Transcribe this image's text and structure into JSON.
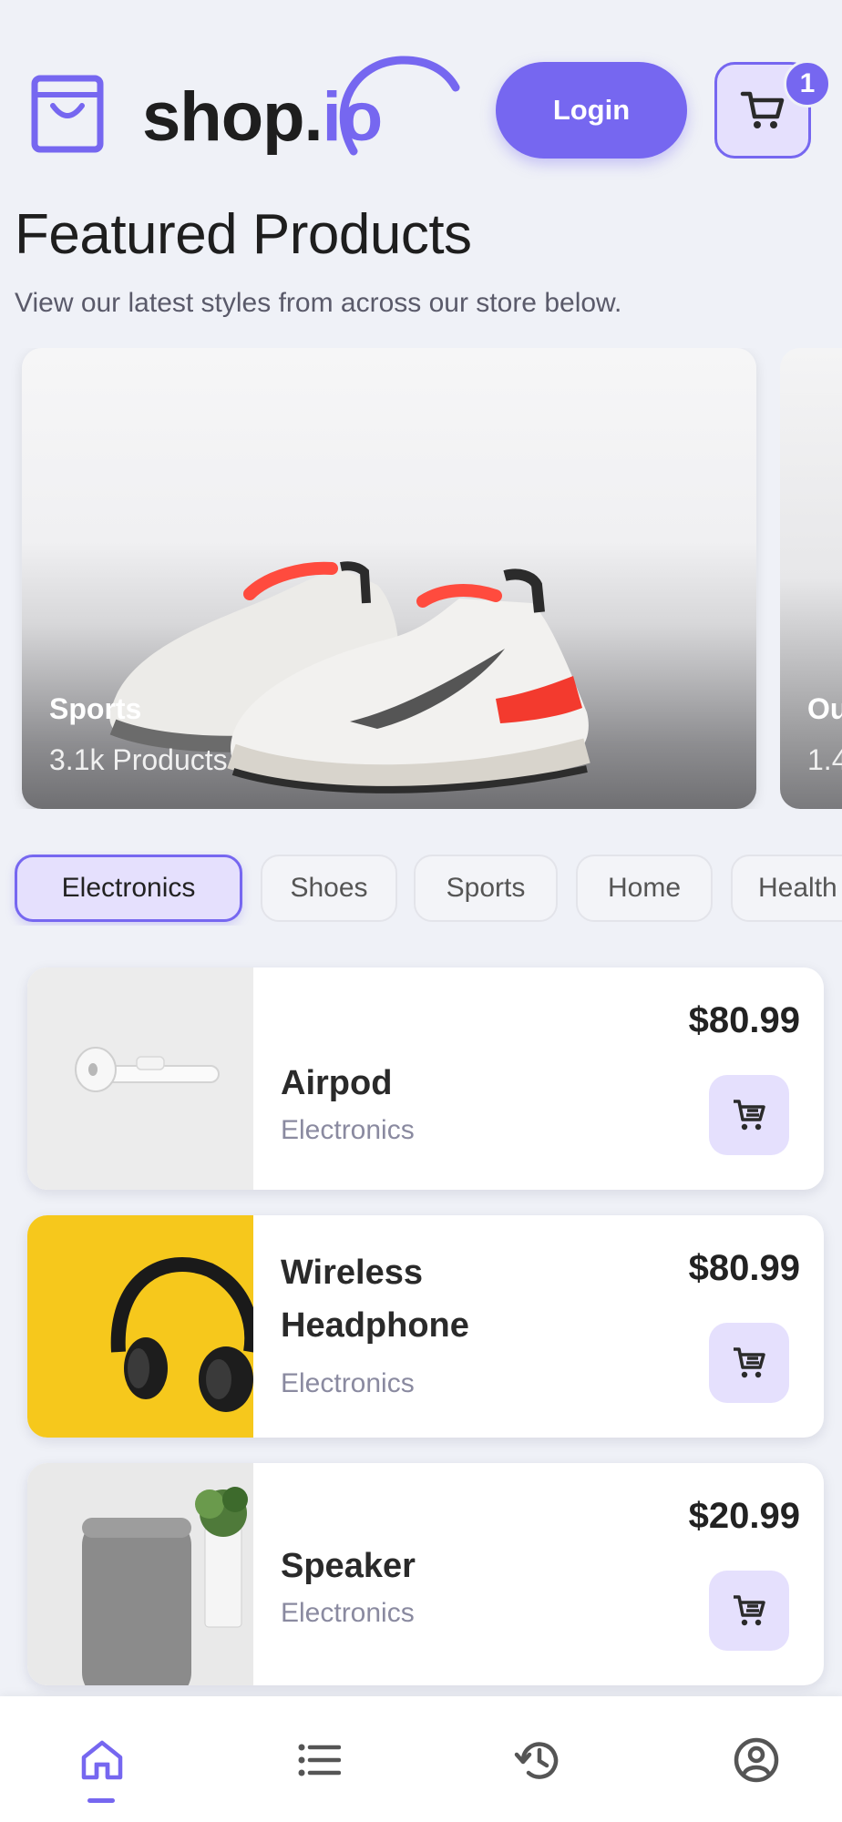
{
  "header": {
    "logo_main": "shop.",
    "logo_accent": "io",
    "login_label": "Login",
    "cart_count": "1"
  },
  "featured": {
    "title": "Featured Products",
    "subtitle": "View our latest styles from across our store below.",
    "cards": [
      {
        "name": "Sports",
        "count": "3.1k Products"
      },
      {
        "name": "Ou",
        "count": "1.4"
      }
    ]
  },
  "categories": [
    "Electronics",
    "Shoes",
    "Sports",
    "Home",
    "Health"
  ],
  "selected_category": "Electronics",
  "products": [
    {
      "name": "Airpod",
      "category": "Electronics",
      "price": "$80.99"
    },
    {
      "name": "Wireless Headphone",
      "category": "Electronics",
      "price": "$80.99"
    },
    {
      "name": "Speaker",
      "category": "Electronics",
      "price": "$20.99"
    }
  ],
  "bottom_nav": {
    "items": [
      "home-icon",
      "list-icon",
      "history-icon",
      "profile-icon"
    ],
    "active": "home-icon"
  },
  "colors": {
    "accent": "#7667f0",
    "accent_light": "#e5e0fd",
    "background": "#eff1f7",
    "thumb_yellow": "#f6c81c"
  }
}
